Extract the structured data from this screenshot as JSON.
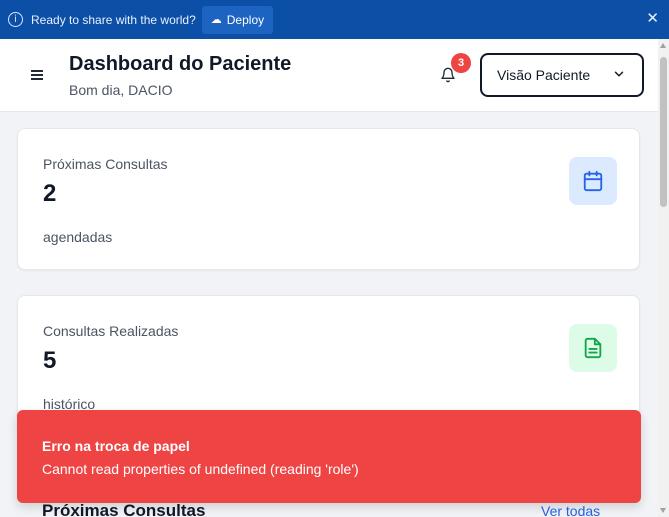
{
  "banner": {
    "message": "Ready to share with the world?",
    "deploy_label": "Deploy",
    "close_glyph": "✕",
    "info_glyph": "i",
    "deploy_glyph": "☁"
  },
  "header": {
    "title": "Dashboard do Paciente",
    "greeting": "Bom dia, DACIO",
    "notification_count": "3",
    "role_select_value": "Visão Paciente"
  },
  "cards": [
    {
      "label": "Próximas Consultas",
      "value": "2",
      "sub": "agendadas",
      "icon": "calendar-icon",
      "icon_bg": "#dbeafe",
      "icon_color": "#2563eb"
    },
    {
      "label": "Consultas Realizadas",
      "value": "5",
      "sub": "histórico",
      "icon": "document-icon",
      "icon_bg": "#dcfce7",
      "icon_color": "#16a34a"
    }
  ],
  "section": {
    "title": "Próximas Consultas",
    "see_all_label": "Ver todas"
  },
  "toast": {
    "title": "Erro na troca de papel",
    "message": "Cannot read properties of undefined (reading 'role')",
    "color": "#ef4444"
  },
  "colors": {
    "banner_bg": "#0b4fa6",
    "accent": "#2563eb",
    "badge": "#ef4444"
  }
}
